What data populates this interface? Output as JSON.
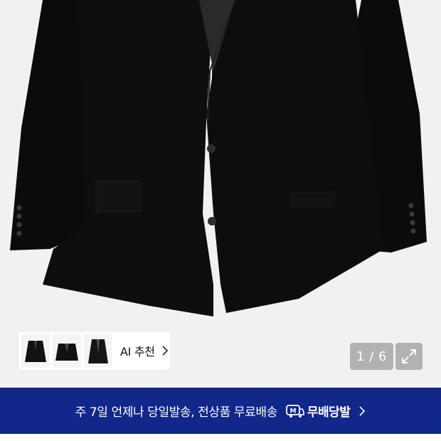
{
  "product_viewer": {
    "image_icon": "black-blazer-photo",
    "ai_recommend": {
      "label": "AI 추천",
      "thumbnails": [
        "black-blazer-thumb",
        "black-blazer-thumb",
        "black-blazer-thumb"
      ],
      "chevron_icon": "chevron-right-icon"
    },
    "counter": "1 / 6",
    "expand_icon": "expand-icon"
  },
  "delivery_banner": {
    "text": "주 7일 언제나 당일발송, 전상품 무료배송",
    "badge_icon": "truck-m-icon",
    "badge_label": "무배당발",
    "chevron_icon": "chevron-right-icon",
    "background": "#11278a"
  }
}
